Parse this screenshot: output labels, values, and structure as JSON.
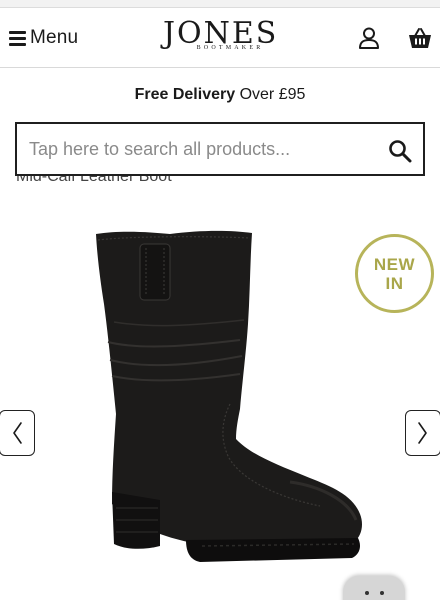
{
  "header": {
    "menu_label": "Menu",
    "logo_main": "JONES",
    "logo_sub": "BOOTMAKER",
    "account_icon": "user-icon",
    "basket_icon": "basket-icon"
  },
  "promo": {
    "bold": "Free Delivery",
    "rest": " Over £95"
  },
  "search": {
    "placeholder": "Tap here to search all products...",
    "icon": "search-icon"
  },
  "product": {
    "title": "Mid-Calf Leather Boot",
    "badge_line1": "NEW",
    "badge_line2": "IN"
  },
  "carousel": {
    "prev_icon": "chevron-left-icon",
    "next_icon": "chevron-right-icon"
  },
  "colors": {
    "badge_green": "#b7b45a",
    "text": "#1a1a1a",
    "boot": "#1c1b1a"
  }
}
